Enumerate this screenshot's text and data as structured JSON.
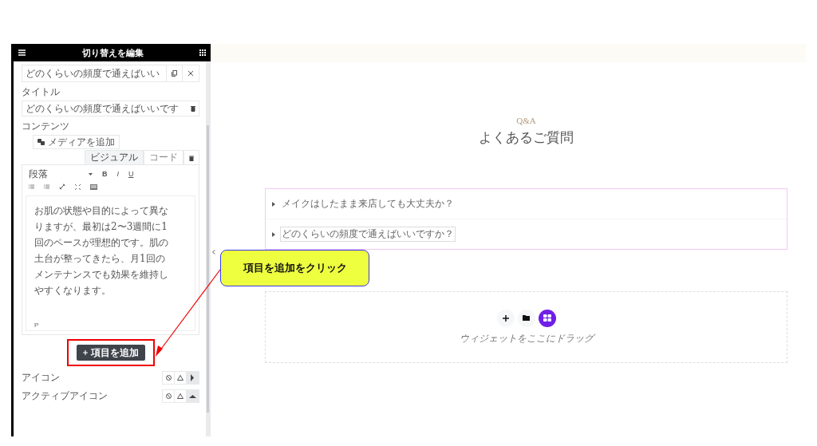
{
  "panel": {
    "title": "切り替えを編集",
    "item": {
      "header": "どのくらいの頻度で通えばいい",
      "title_label": "タイトル",
      "title_value": "どのくらいの頻度で通えばいいです",
      "content_label": "コンテンツ",
      "add_media": "メディアを追加",
      "editor_tabs": [
        {
          "label": "ビジュアル",
          "selected": true
        },
        {
          "label": "コード",
          "selected": false
        }
      ],
      "format": "段落",
      "format_buttons": [
        "B",
        "I",
        "U"
      ],
      "body": "お肌の状態や目的によって異なりますが、最初は2〜3週間に1回のペースが理想的です。肌の土台が整ってきたら、月1回のメンテナンスでも効果を維持しやすくなります。",
      "path": "P"
    },
    "add_item": "項目を追加",
    "icon_rows": [
      {
        "label": "アイコン",
        "kind": "right"
      },
      {
        "label": "アクティブアイコン",
        "kind": "up"
      }
    ]
  },
  "preview": {
    "eyebrow": "Q&A",
    "heading": "よくあるご質問",
    "faq": [
      {
        "question": "メイクはしたまま来店しても大丈夫か？",
        "selected": false
      },
      {
        "question": "どのくらいの頻度で通えばいいですか？",
        "selected": true
      }
    ],
    "drop_hint": "ウィジェットをここにドラッグ"
  },
  "callout": {
    "text": "項目を追加をクリック"
  }
}
